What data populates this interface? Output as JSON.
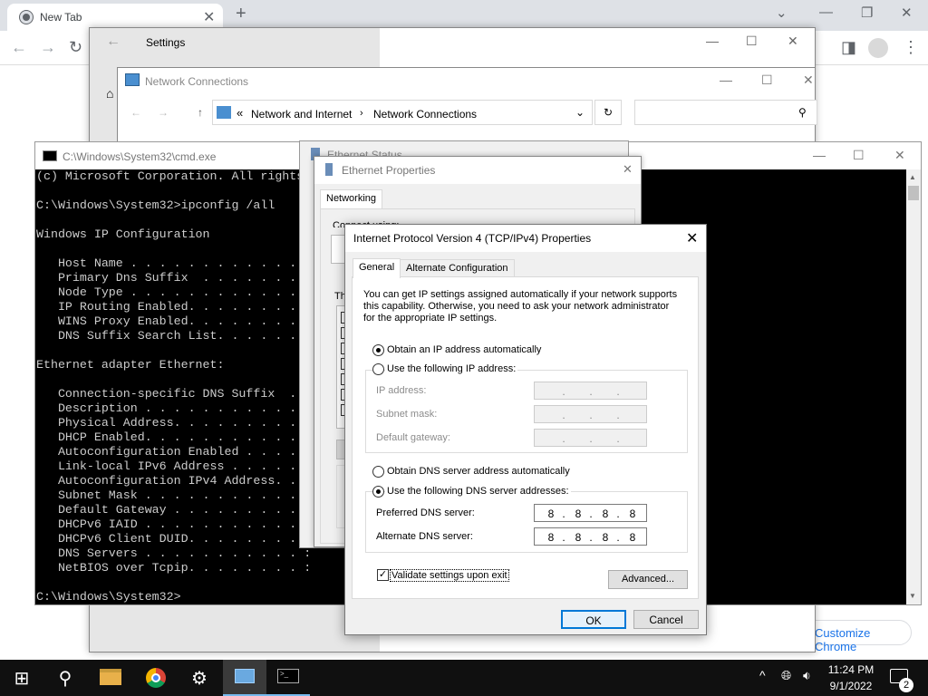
{
  "chrome": {
    "tab_title": "New Tab",
    "customize_label": "Customize Chrome"
  },
  "settings": {
    "title": "Settings"
  },
  "network_connections": {
    "title": "Network Connections",
    "breadcrumb": [
      "Network and Internet",
      "Network Connections"
    ]
  },
  "cmd": {
    "title": "C:\\Windows\\System32\\cmd.exe",
    "lines": [
      "(c) Microsoft Corporation. All rights reserved.",
      "",
      "C:\\Windows\\System32>ipconfig /all",
      "",
      "Windows IP Configuration",
      "",
      "   Host Name . . . . . . . . . . . . :",
      "   Primary Dns Suffix  . . . . . . . :",
      "   Node Type . . . . . . . . . . . . :",
      "   IP Routing Enabled. . . . . . . . :",
      "   WINS Proxy Enabled. . . . . . . . :",
      "   DNS Suffix Search List. . . . . . :",
      "",
      "Ethernet adapter Ethernet:",
      "",
      "   Connection-specific DNS Suffix  . :",
      "   Description . . . . . . . . . . . :",
      "   Physical Address. . . . . . . . . :",
      "   DHCP Enabled. . . . . . . . . . . :",
      "   Autoconfiguration Enabled . . . . :",
      "   Link-local IPv6 Address . . . . . :",
      "   Autoconfiguration IPv4 Address. . :",
      "   Subnet Mask . . . . . . . . . . . :",
      "   Default Gateway . . . . . . . . . :",
      "   DHCPv6 IAID . . . . . . . . . . . :",
      "   DHCPv6 Client DUID. . . . . . . . :",
      "   DNS Servers . . . . . . . . . . . :",
      "   NetBIOS over Tcpip. . . . . . . . :",
      "",
      "C:\\Windows\\System32>"
    ]
  },
  "ethernet_status": {
    "title": "Ethernet Status"
  },
  "ethernet_properties": {
    "title": "Ethernet Properties",
    "tab_networking": "Networking",
    "connect_using_label": "Connect using:",
    "this_connection_label": "Th"
  },
  "ipv4": {
    "title": "Internet Protocol Version 4 (TCP/IPv4) Properties",
    "tab_general": "General",
    "tab_alternate": "Alternate Configuration",
    "info_line1": "You can get IP settings assigned automatically if your network supports",
    "info_line2": "this capability. Otherwise, you need to ask your network administrator",
    "info_line3": "for the appropriate IP settings.",
    "obtain_ip_auto": "Obtain an IP address automatically",
    "use_following_ip": "Use the following IP address:",
    "ip_address_label": "IP address:",
    "subnet_mask_label": "Subnet mask:",
    "default_gateway_label": "Default gateway:",
    "obtain_dns_auto": "Obtain DNS server address automatically",
    "use_following_dns": "Use the following DNS server addresses:",
    "preferred_dns_label": "Preferred DNS server:",
    "alternate_dns_label": "Alternate DNS server:",
    "preferred_dns": [
      "8",
      "8",
      "8",
      "8"
    ],
    "alternate_dns": [
      "8",
      "8",
      "8",
      "8"
    ],
    "validate_label": "Validate settings upon exit",
    "advanced_button": "Advanced...",
    "ok_button": "OK",
    "cancel_button": "Cancel"
  },
  "taskbar": {
    "time": "11:24 PM",
    "date": "9/1/2022",
    "notification_count": "2"
  },
  "colors": {
    "accent": "#0078d7",
    "taskbar": "#101010"
  }
}
